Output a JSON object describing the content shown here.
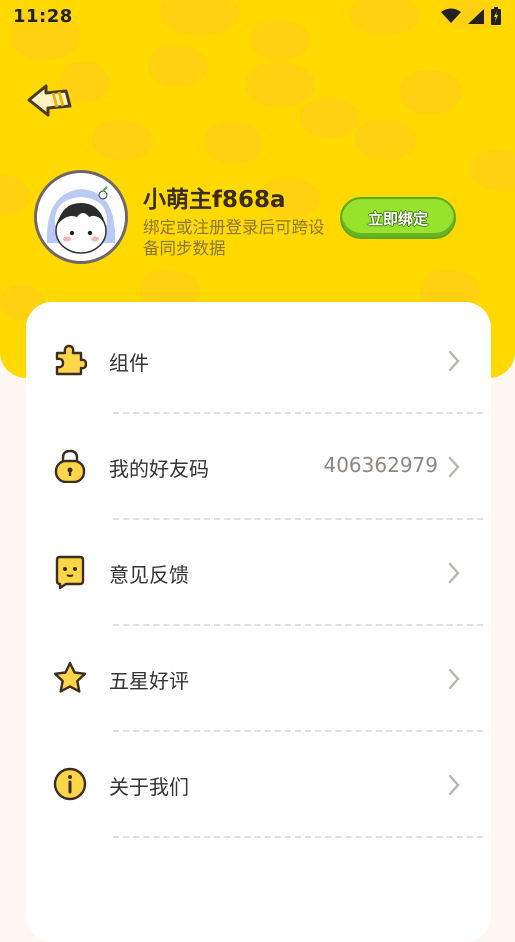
{
  "status_bar": {
    "time": "11:28"
  },
  "profile": {
    "username": "小萌主f868a",
    "bind_hint": "绑定或注册登录后可跨设备同步数据",
    "bind_button": "立即绑定"
  },
  "menu": [
    {
      "label": "组件",
      "value": "",
      "icon": "puzzle-icon"
    },
    {
      "label": "我的好友码",
      "value": "406362979",
      "icon": "lock-icon"
    },
    {
      "label": "意见反馈",
      "value": "",
      "icon": "feedback-icon"
    },
    {
      "label": "五星好评",
      "value": "",
      "icon": "star-icon"
    },
    {
      "label": "关于我们",
      "value": "",
      "icon": "info-icon"
    }
  ],
  "colors": {
    "header": "#FFD900",
    "button_green": "#96E22C",
    "background": "#FFF7F4"
  }
}
